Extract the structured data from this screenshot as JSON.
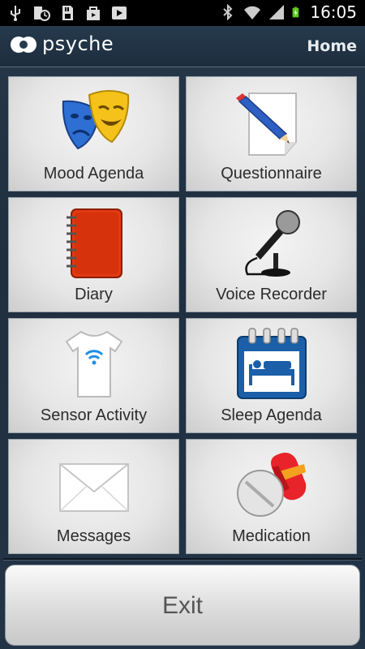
{
  "status_bar": {
    "time": "16:05",
    "left_icons": [
      "usb-icon",
      "clock-icon",
      "sd-card-icon",
      "shop-icon",
      "play-icon"
    ],
    "right_icons": [
      "bluetooth-icon",
      "wifi-icon",
      "signal-icon",
      "battery-charging-icon"
    ]
  },
  "app_bar": {
    "brand": "psyche",
    "title": "Home"
  },
  "tiles": [
    {
      "label": "Mood Agenda",
      "icon": "theater-masks-icon"
    },
    {
      "label": "Questionnaire",
      "icon": "pencil-note-icon"
    },
    {
      "label": "Diary",
      "icon": "notebook-icon"
    },
    {
      "label": "Voice Recorder",
      "icon": "microphone-icon"
    },
    {
      "label": "Sensor Activity",
      "icon": "sensor-shirt-icon"
    },
    {
      "label": "Sleep Agenda",
      "icon": "bed-calendar-icon"
    },
    {
      "label": "Messages",
      "icon": "envelope-icon"
    },
    {
      "label": "Medication",
      "icon": "pills-icon"
    }
  ],
  "exit_label": "Exit"
}
